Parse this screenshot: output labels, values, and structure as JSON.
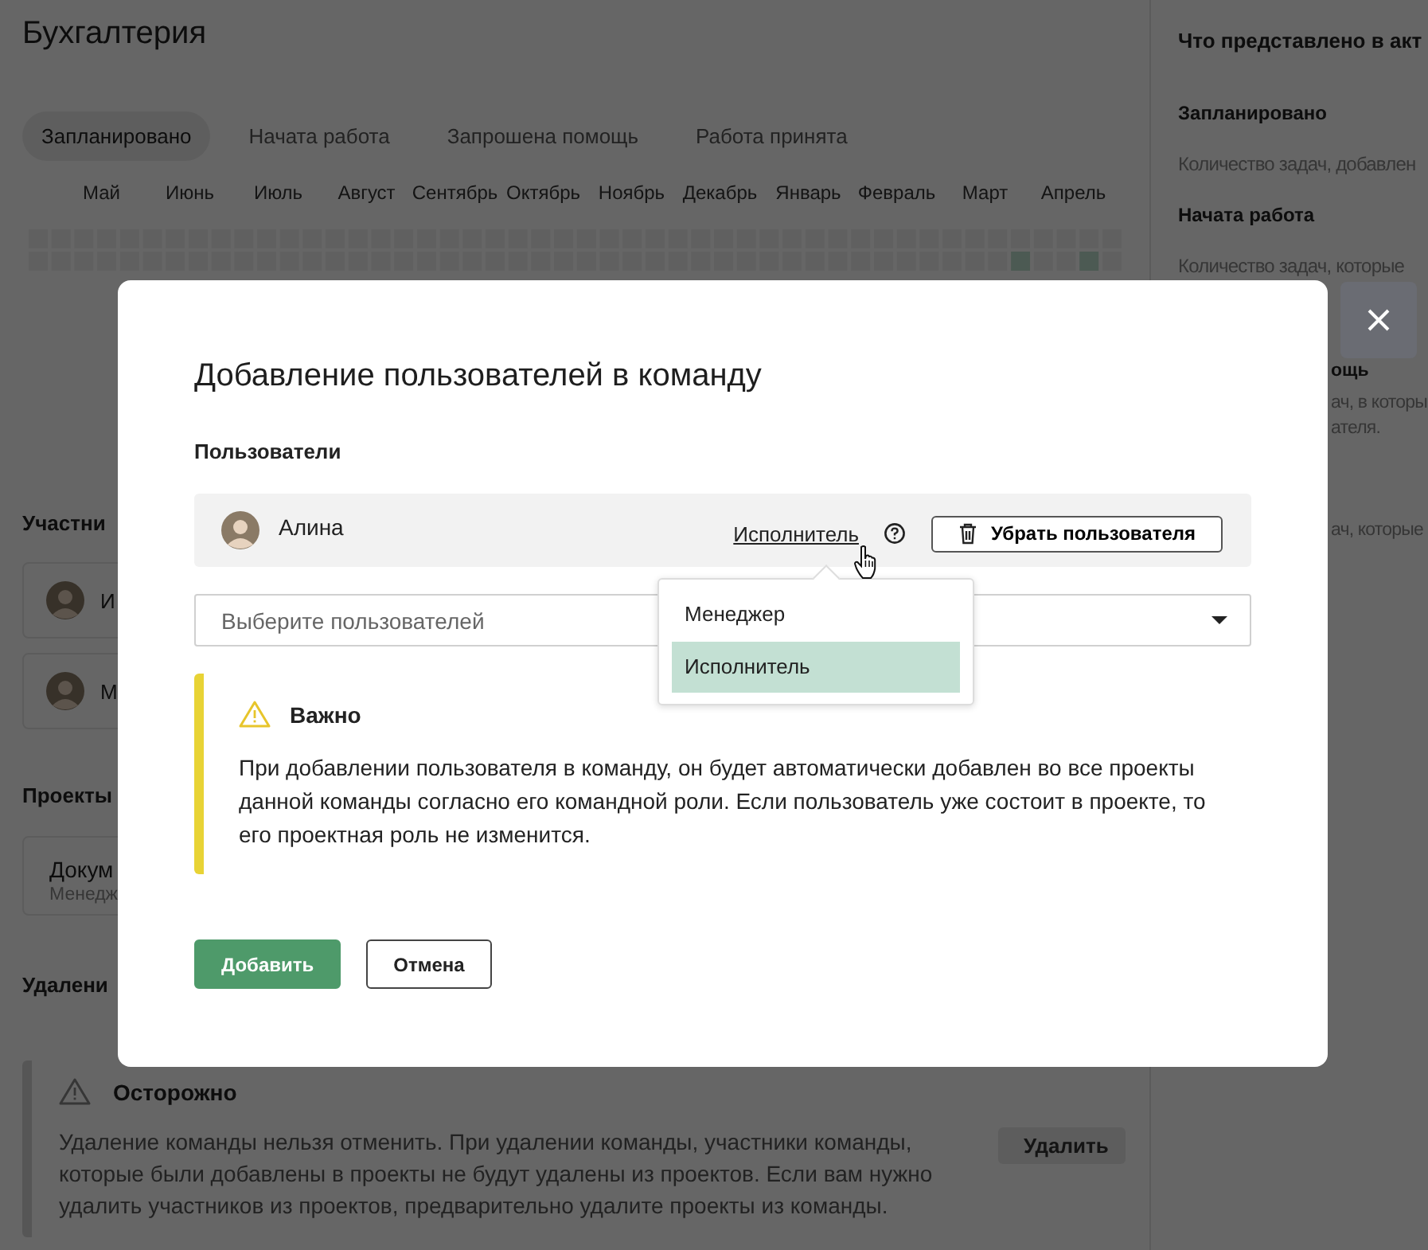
{
  "page": {
    "title": "Бухгалтерия",
    "tabs": [
      {
        "label": "Запланировано",
        "selected": true
      },
      {
        "label": "Начата работа",
        "selected": false
      },
      {
        "label": "Запрошена помощь",
        "selected": false
      },
      {
        "label": "Работа принята",
        "selected": false
      }
    ],
    "months": [
      "Май",
      "Июнь",
      "Июль",
      "Август",
      "Сентябрь",
      "Октябрь",
      "Ноябрь",
      "Декабрь",
      "Январь",
      "Февраль",
      "Март",
      "Апрель"
    ],
    "members_heading": "Участни",
    "members": [
      {
        "name": "И"
      },
      {
        "name": "М"
      }
    ],
    "projects_heading": "Проекты",
    "projects": [
      {
        "name": "Докум",
        "role": "Менедж"
      }
    ],
    "delete_heading": "Удалени",
    "caution": {
      "title": "Осторожно",
      "text": "Удаление команды нельзя отменить. При удалении команды, участники команды, которые были добавлены в проекты не будут удалены из проектов. Если вам нужно удалить участников из проектов, предварительно удалите проекты из команды.",
      "button": "Удалить"
    }
  },
  "info_panel": {
    "title": "Что представлено в акт",
    "sections": [
      {
        "kind": "full",
        "heading": "Запланировано",
        "lines": [
          "Количество задач, добавлен"
        ]
      },
      {
        "kind": "full",
        "heading": "Начата работа",
        "lines": [
          "Количество задач, которые"
        ]
      },
      {
        "kind": "fragment",
        "heading": "ощь",
        "lines": [
          "ач, в которы",
          "ателя."
        ]
      },
      {
        "kind": "fragment",
        "lines": [
          "ач, которые"
        ]
      }
    ]
  },
  "modal": {
    "title": "Добавление пользователей в команду",
    "users_label": "Пользователи",
    "users": [
      {
        "name": "Алина",
        "role": "Исполнитель",
        "remove_button": "Убрать пользователя"
      }
    ],
    "select": {
      "placeholder": "Выберите пользователей"
    },
    "role_menu": [
      {
        "label": "Менеджер",
        "selected": false
      },
      {
        "label": "Исполнитель",
        "selected": true
      }
    ],
    "notice": {
      "title": "Важно",
      "text": "При добавлении пользователя в команду, он будет автоматически добавлен во все проекты данной команды согласно его командной роли. Если пользователь уже состоит в проекте, то его проектная роль не изменится."
    },
    "buttons": [
      {
        "label": "Добавить",
        "kind": "primary"
      },
      {
        "label": "Отмена",
        "kind": "secondary"
      }
    ]
  }
}
